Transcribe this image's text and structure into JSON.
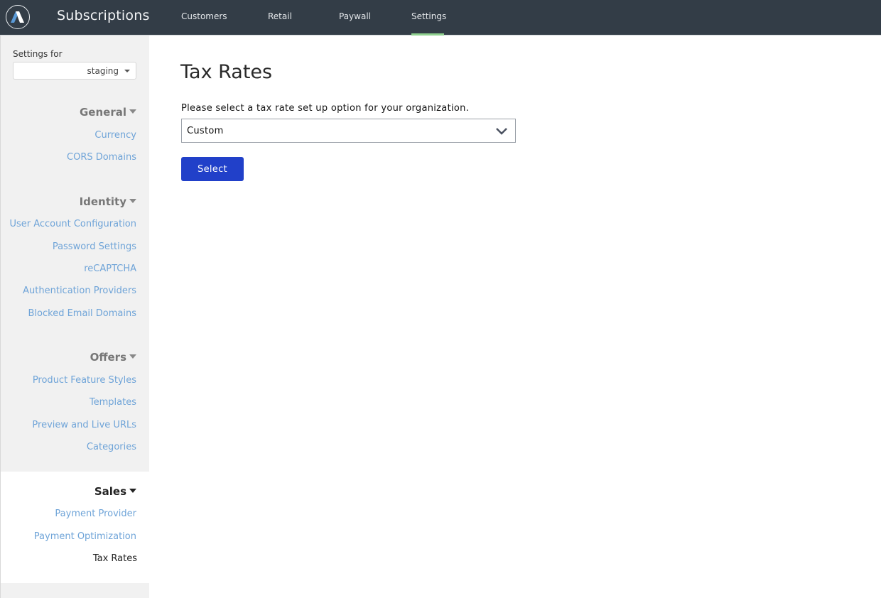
{
  "app": {
    "title": "Subscriptions",
    "logo": "arc-logo-icon"
  },
  "nav": {
    "items": [
      {
        "label": "Customers"
      },
      {
        "label": "Retail"
      },
      {
        "label": "Paywall"
      },
      {
        "label": "Settings",
        "active": true
      }
    ],
    "active_underline_color": "#8fd18f"
  },
  "sidebar": {
    "settings_for_label": "Settings for",
    "environment": "staging",
    "sections": [
      {
        "title": "General",
        "links": [
          "Currency",
          "CORS Domains"
        ]
      },
      {
        "title": "Identity",
        "links": [
          "User Account Configuration",
          "Password Settings",
          "reCAPTCHA",
          "Authentication Providers",
          "Blocked Email Domains"
        ]
      },
      {
        "title": "Offers",
        "links": [
          "Product Feature Styles",
          "Templates",
          "Preview and Live URLs",
          "Categories"
        ]
      },
      {
        "title": "Sales",
        "active": true,
        "links": [
          "Payment Provider",
          "Payment Optimization",
          "Tax Rates"
        ],
        "current_link": "Tax Rates"
      }
    ]
  },
  "main": {
    "title": "Tax Rates",
    "prompt": "Please select a tax rate set up option for your organization.",
    "tax_option": "Custom",
    "select_button": "Select"
  },
  "colors": {
    "header_bg": "#333d47",
    "link": "#6fa4d8",
    "primary_button": "#2140c9"
  }
}
